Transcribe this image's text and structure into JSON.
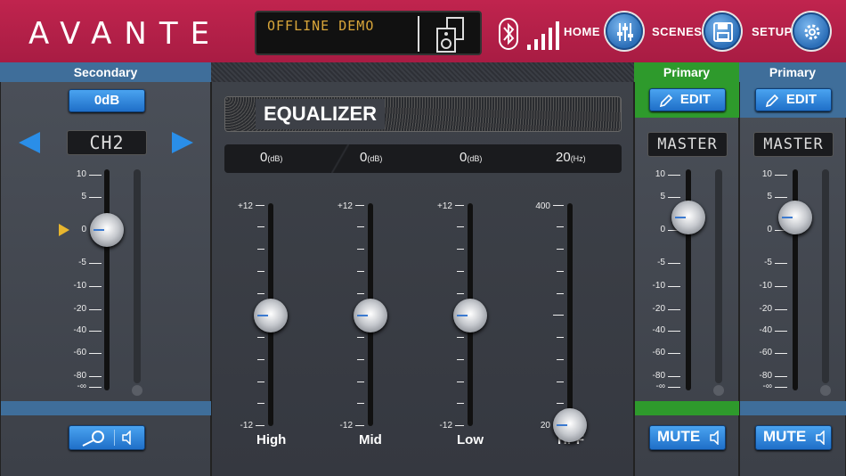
{
  "header": {
    "logo": "AVANTE",
    "lcd_text": "OFFLINE DEMO",
    "nav": [
      {
        "label": "HOME"
      },
      {
        "label": "SCENES"
      },
      {
        "label": "SETUP"
      }
    ]
  },
  "secondary": {
    "title": "Secondary",
    "gain_label": "0dB",
    "channel": "CH2",
    "scale": [
      "10",
      "5",
      "0",
      "-5",
      "-10",
      "-20",
      "-40",
      "-60",
      "-80",
      "-∞"
    ]
  },
  "equalizer": {
    "title": "EQUALIZER",
    "values": [
      {
        "value": "0",
        "unit": "(dB)"
      },
      {
        "value": "0",
        "unit": "(dB)"
      },
      {
        "value": "0",
        "unit": "(dB)"
      },
      {
        "value": "20",
        "unit": "(Hz)"
      }
    ],
    "bands": [
      {
        "label": "High",
        "top": "+12",
        "bottom": "-12"
      },
      {
        "label": "Mid",
        "top": "+12",
        "bottom": "-12"
      },
      {
        "label": "Low",
        "top": "+12",
        "bottom": "-12"
      },
      {
        "label": "HPF",
        "top": "400",
        "bottom": "20"
      }
    ]
  },
  "primary1": {
    "title": "Primary",
    "edit_label": "EDIT",
    "display": "MASTER",
    "mute_label": "MUTE",
    "scale": [
      "10",
      "5",
      "0",
      "-5",
      "-10",
      "-20",
      "-40",
      "-60",
      "-80",
      "-∞"
    ]
  },
  "primary2": {
    "title": "Primary",
    "edit_label": "EDIT",
    "display": "MASTER",
    "mute_label": "MUTE",
    "scale": [
      "10",
      "5",
      "0",
      "-5",
      "-10",
      "-20",
      "-40",
      "-60",
      "-80",
      "-∞"
    ]
  },
  "colors": {
    "brand": "#b3204a",
    "accent_blue": "#2a7fd8",
    "primary_green": "#2e9a2c"
  }
}
